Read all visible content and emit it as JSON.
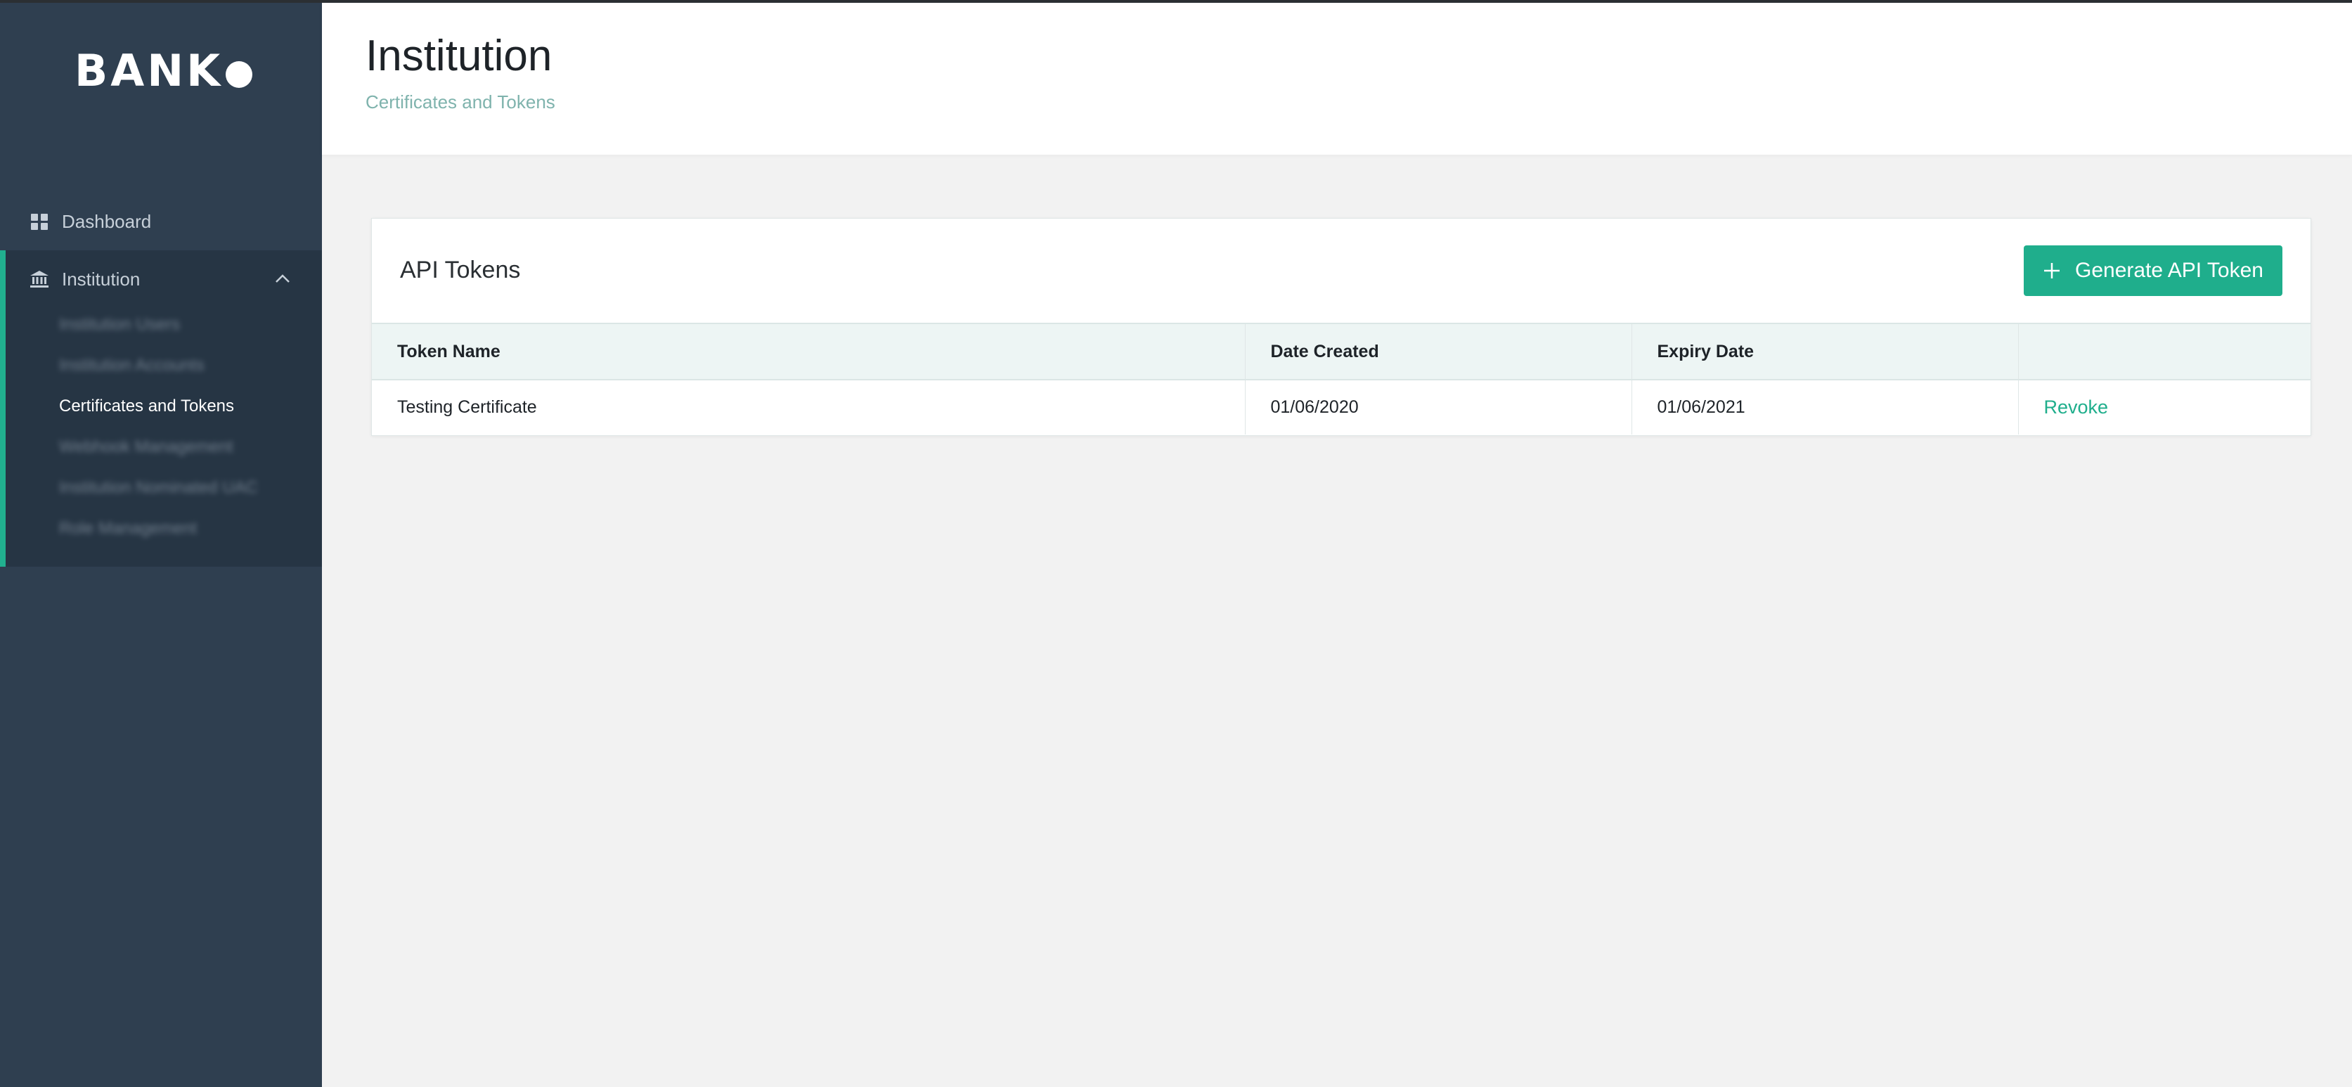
{
  "sidebar": {
    "logo": "BANK",
    "nav": [
      {
        "label": "Dashboard",
        "icon": "grid-icon"
      },
      {
        "label": "Institution",
        "icon": "bank-icon",
        "expanded": true
      }
    ],
    "institution_items": [
      {
        "label": "Institution Users",
        "blurred": true
      },
      {
        "label": "Institution Accounts",
        "blurred": true
      },
      {
        "label": "Certificates and Tokens",
        "blurred": false,
        "active": true
      },
      {
        "label": "Webhook Management",
        "blurred": true
      },
      {
        "label": "Institution Nominated UAC",
        "blurred": true
      },
      {
        "label": "Role Management",
        "blurred": true
      }
    ]
  },
  "header": {
    "title": "Institution",
    "subtitle": "Certificates and Tokens"
  },
  "card": {
    "title": "API Tokens",
    "generate_button": "Generate API Token",
    "table": {
      "columns": [
        "Token Name",
        "Date Created",
        "Expiry Date",
        ""
      ],
      "rows": [
        {
          "name": "Testing Certificate",
          "created": "01/06/2020",
          "expiry": "01/06/2021",
          "action": "Revoke"
        }
      ]
    }
  },
  "colors": {
    "sidebar_bg": "#2f3f50",
    "sidebar_active_group_bg": "#263544",
    "accent": "#1fae8c",
    "subtitle": "#7fb3ad",
    "table_header_bg": "#edf5f4",
    "page_bg": "#f2f2f2"
  }
}
